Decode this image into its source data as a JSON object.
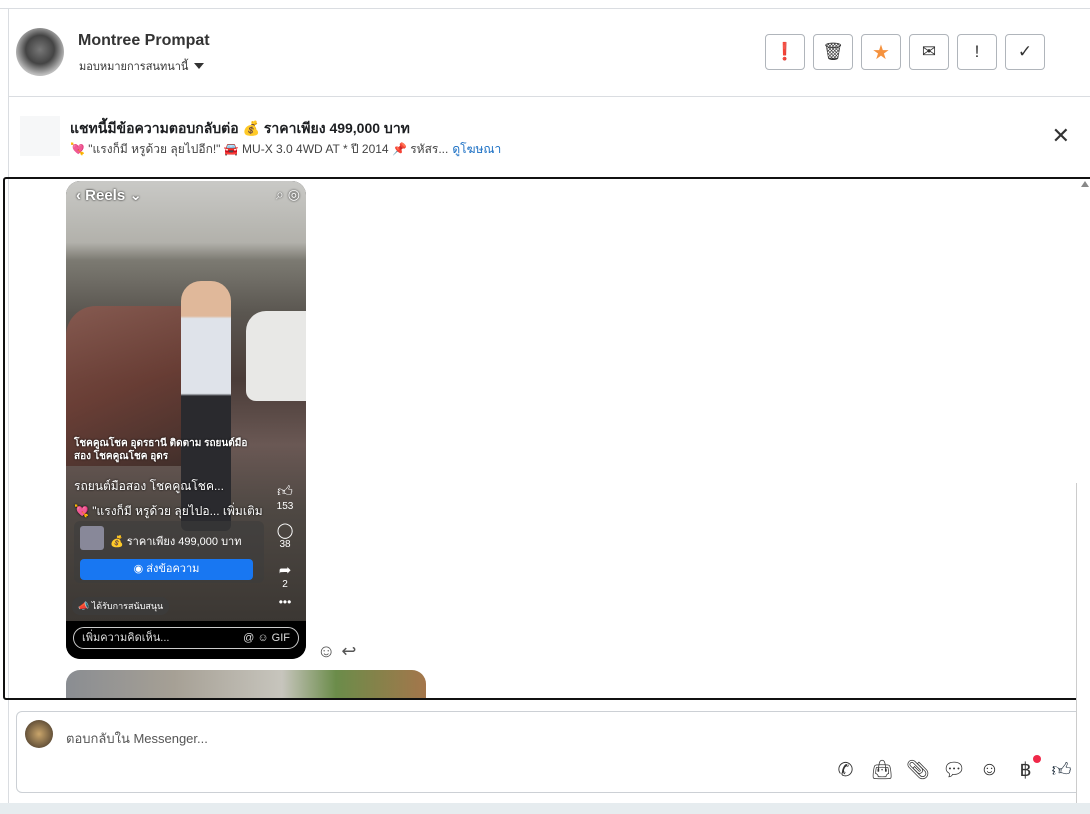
{
  "header": {
    "name": "Montree Prompat",
    "assign_label": "มอบหมายการสนทนานี้",
    "actions": [
      {
        "icon": "alert-circle-icon",
        "glyph": "❗"
      },
      {
        "icon": "trash-icon",
        "glyph": "🗑"
      },
      {
        "icon": "star-icon",
        "glyph": "★",
        "color": "#f5923e"
      },
      {
        "icon": "envelope-open-icon",
        "glyph": "✉"
      },
      {
        "icon": "exclamation-icon",
        "glyph": "!"
      },
      {
        "icon": "check-icon",
        "glyph": "✓"
      }
    ]
  },
  "banner": {
    "title": "แชทนี้มีข้อความตอบกลับต่อ 💰 ราคาเพียง 499,000 บาท",
    "subtitle": "💘 \"แรงก็มี หรูด้วย ลุยไปอีก!\" 🚘 MU-X 3.0 4WD AT * ปี 2014 📌 รหัสร...",
    "link": "ดูโฆษณา",
    "close": "✕"
  },
  "reel": {
    "header": "‹ Reels ⌄",
    "page_line": "โชคคูณโชค อุดรธานี ติดตาม รถยนต์มือสอง โชคคูณโชค อุดร",
    "page_name": "รถยนต์มือสอง โชคคูณโชค...",
    "caption": "💘 \"แรงก็มี หรูด้วย ลุยไปอ... เพิ่มเติม",
    "likes": "153",
    "comments": "38",
    "shares": "2",
    "price": "💰 ราคาเพียง 499,000 บาท",
    "send_button": "ส่งข้อความ",
    "sponsored": "📣 ได้รับการสนับสนุน",
    "comment_placeholder": "เพิ่มความคิดเห็น...",
    "comment_icons": "@ ☺ GIF"
  },
  "composer": {
    "placeholder": "ตอบกลับใน Messenger..."
  }
}
